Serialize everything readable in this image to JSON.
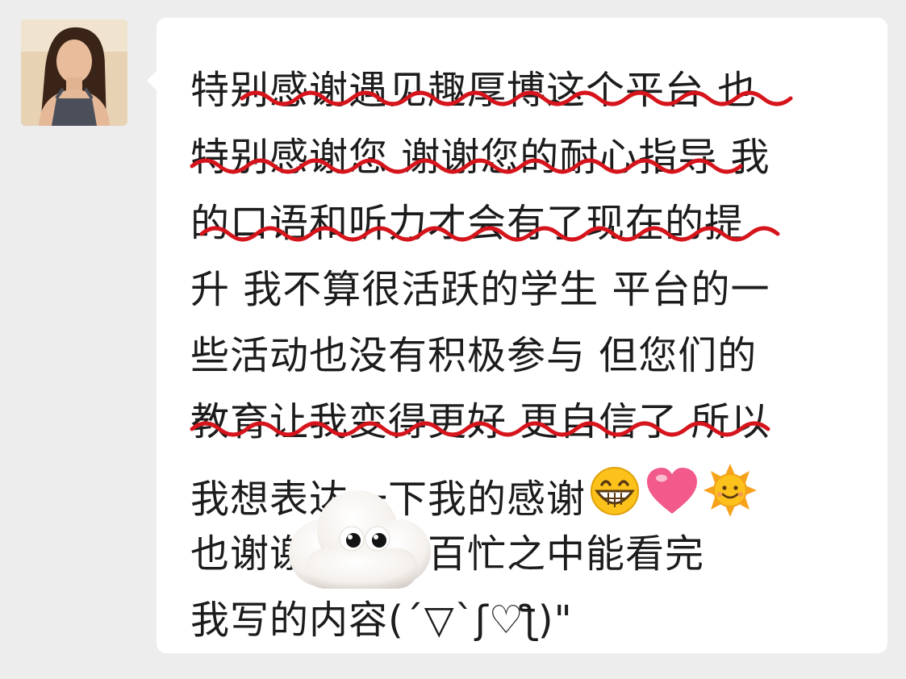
{
  "chat": {
    "message_lines": [
      "特别感谢遇见趣厚博这个平台 也",
      "特别感谢您 谢谢您的耐心指导 我",
      "的口语和听力才会有了现在的提",
      "升 我不算很活跃的学生 平台的一",
      "些活动也没有积极参与 但您们的",
      "教育让我变得更好 更自信了 所以",
      "我想表达一下我的感谢",
      "也谢谢老老师百忙之中能看完",
      "我写的内容(´▽`ʃ♡ƪ)\""
    ],
    "inline_emojis": [
      "grinning-face-icon",
      "pink-heart-icon",
      "sun-with-face-icon"
    ],
    "sticker": "cloud-with-eyes-icon",
    "underline_color": "#d6141c",
    "bubble_color": "#ffffff",
    "background_color": "#ededed"
  }
}
